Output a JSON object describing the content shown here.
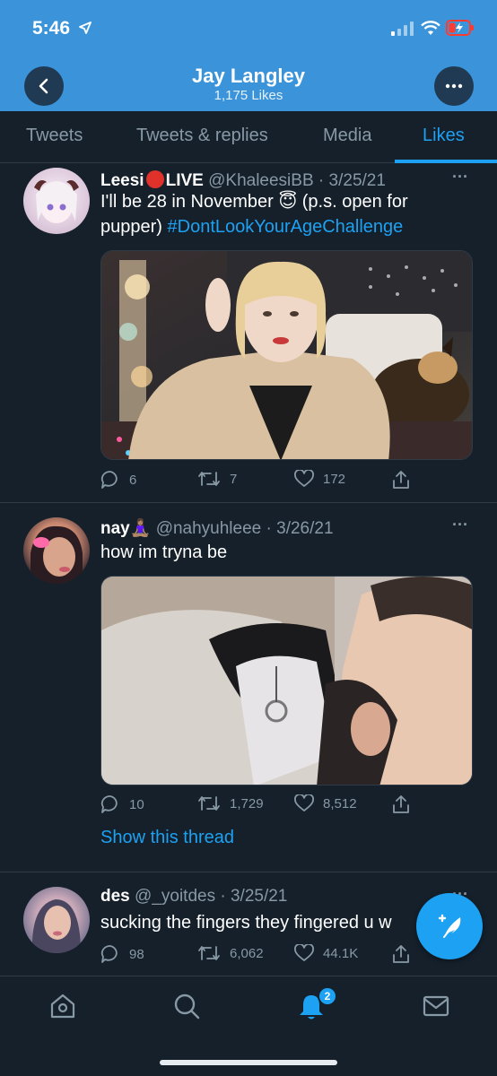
{
  "status_bar": {
    "time": "5:46"
  },
  "header": {
    "name": "Jay Langley",
    "likes": "1,175 Likes"
  },
  "tabs": [
    {
      "label": "Tweets"
    },
    {
      "label": "Tweets & replies"
    },
    {
      "label": "Media"
    },
    {
      "label": "Likes"
    }
  ],
  "active_tab": "Likes",
  "tweets": [
    {
      "name": "Leesi",
      "name_suffix": "LIVE",
      "handle": "@KhaleesiBB",
      "date": "3/25/21",
      "text_1": "I'll be 28 in November 😇  (p.s. open for",
      "text_2": "pupper)",
      "hashtag": "#DontLookYourAgeChallenge",
      "replies": "6",
      "retweets": "7",
      "likes": "172"
    },
    {
      "name": "nay🧘🏽‍♀️",
      "handle": "@nahyuhleee",
      "date": "3/26/21",
      "text": "how im tryna be",
      "replies": "10",
      "retweets": "1,729",
      "likes": "8,512",
      "show_thread": "Show this thread"
    },
    {
      "name": "des",
      "handle": "@_yoitdes",
      "date": "3/25/21",
      "text": "sucking the fingers they fingered u w",
      "replies": "98",
      "retweets": "6,062",
      "likes": "44.1K"
    }
  ],
  "notifications_badge": "2",
  "colors": {
    "background": "#15202b",
    "header": "#3b94d9",
    "accent": "#1da1f2",
    "muted": "#8899a6"
  }
}
